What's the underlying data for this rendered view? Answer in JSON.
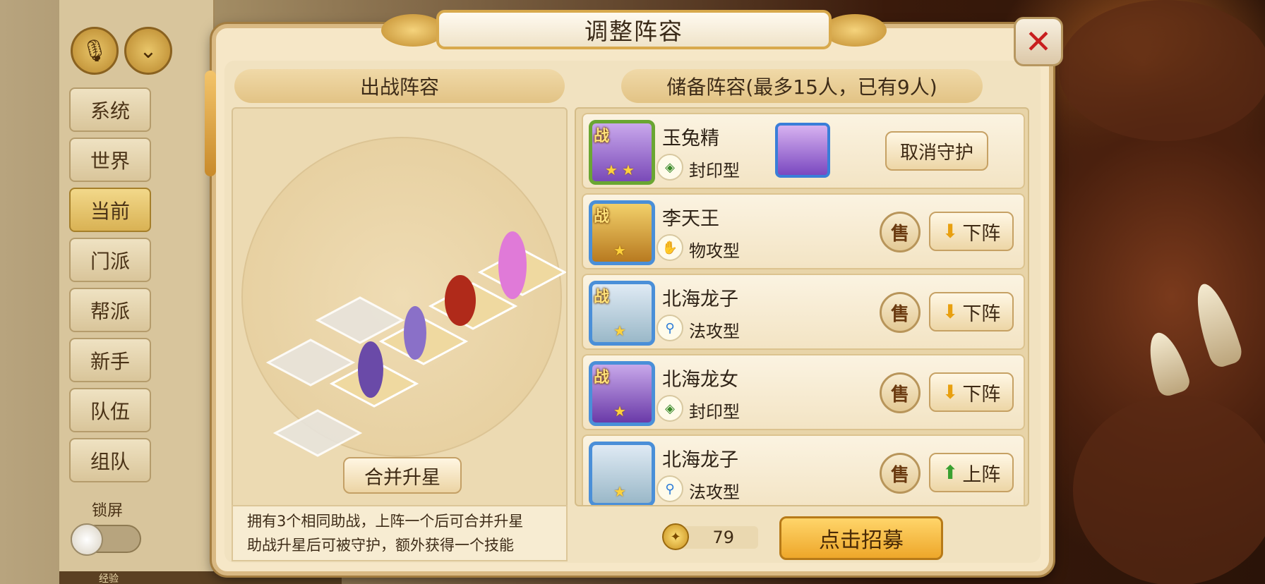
{
  "background": {
    "accent": "#7a3a1c"
  },
  "chat": {
    "channels": [
      {
        "label": "系统",
        "active": false
      },
      {
        "label": "世界",
        "active": false
      },
      {
        "label": "当前",
        "active": true
      },
      {
        "label": "门派",
        "active": false
      },
      {
        "label": "帮派",
        "active": false
      },
      {
        "label": "新手",
        "active": false
      },
      {
        "label": "队伍",
        "active": false
      },
      {
        "label": "组队",
        "active": false
      }
    ],
    "lock_label": "锁屏",
    "bottom_label": "经验"
  },
  "dialog": {
    "title": "调整阵容",
    "left_header": "出战阵容",
    "right_header": "储备阵容(最多15人，已有9人)",
    "merge_button": "合并升星",
    "hint_line1": "拥有3个相同助战，上阵一个后可合并升星",
    "hint_line2": "助战升星后可被守护，额外获得一个技能",
    "coin_value": "79",
    "recruit_button": "点击招募"
  },
  "roster": [
    {
      "name": "玉兔精",
      "type": "封印型",
      "badge": "战",
      "stars": 2,
      "action": "取消守护",
      "guarded": true
    },
    {
      "name": "李天王",
      "type": "物攻型",
      "badge": "战",
      "stars": 1,
      "sell": "售",
      "action": "下阵"
    },
    {
      "name": "北海龙子",
      "type": "法攻型",
      "badge": "战",
      "stars": 1,
      "sell": "售",
      "action": "下阵"
    },
    {
      "name": "北海龙女",
      "type": "封印型",
      "badge": "战",
      "stars": 1,
      "sell": "售",
      "action": "下阵"
    },
    {
      "name": "北海龙子",
      "type": "法攻型",
      "badge": "",
      "stars": 1,
      "sell": "售",
      "action": "上阵"
    }
  ]
}
